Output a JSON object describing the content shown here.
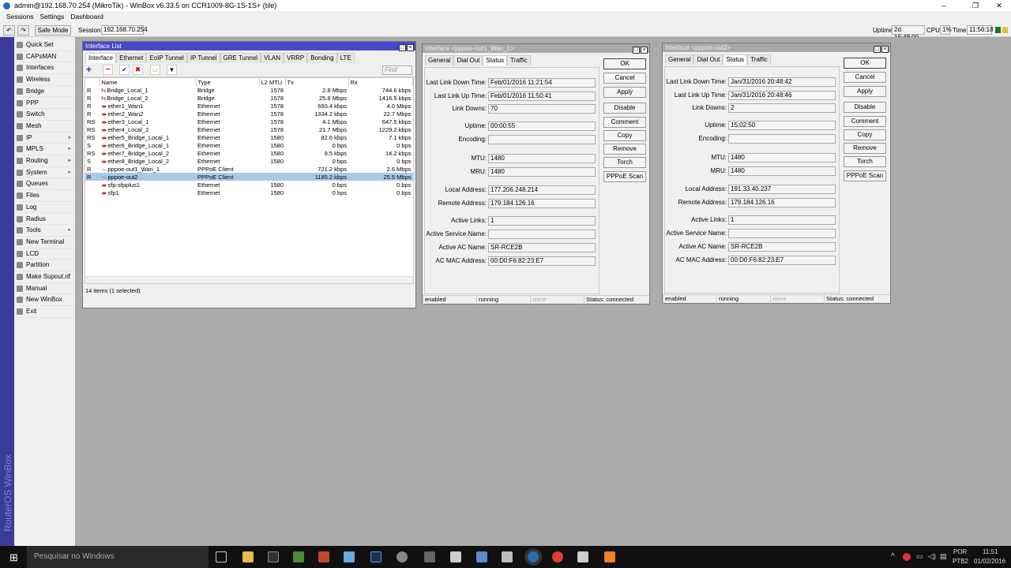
{
  "window": {
    "title": "admin@192.168.70.254 (MikroTik) - WinBox v6.33.5 on CCR1009-8G-1S-1S+ (tile)",
    "minimize": "–",
    "maximize": "❐",
    "close": "✕"
  },
  "menu": [
    "Sessions",
    "Settings",
    "Dashboard"
  ],
  "toolbar": {
    "undo": "↶",
    "redo": "↷",
    "safe_mode": "Safe Mode",
    "session_label": "Session:",
    "session_value": "192.168.70.254",
    "uptime_label": "Uptime:",
    "uptime_value": "2d 16:48:00",
    "cpu_label": "CPU:",
    "cpu_value": "1%",
    "time_label": "Time:",
    "time_value": "11:56:18",
    "status_color": "#1a7a1a"
  },
  "sidebar": {
    "brand": "RouterOS WinBox",
    "items": [
      {
        "label": "Quick Set",
        "arrow": ""
      },
      {
        "label": "CAPsMAN",
        "arrow": ""
      },
      {
        "label": "Interfaces",
        "arrow": ""
      },
      {
        "label": "Wireless",
        "arrow": ""
      },
      {
        "label": "Bridge",
        "arrow": ""
      },
      {
        "label": "PPP",
        "arrow": ""
      },
      {
        "label": "Switch",
        "arrow": ""
      },
      {
        "label": "Mesh",
        "arrow": ""
      },
      {
        "label": "IP",
        "arrow": "▸"
      },
      {
        "label": "MPLS",
        "arrow": "▸"
      },
      {
        "label": "Routing",
        "arrow": "▸"
      },
      {
        "label": "System",
        "arrow": "▸"
      },
      {
        "label": "Queues",
        "arrow": ""
      },
      {
        "label": "Files",
        "arrow": ""
      },
      {
        "label": "Log",
        "arrow": ""
      },
      {
        "label": "Radius",
        "arrow": ""
      },
      {
        "label": "Tools",
        "arrow": "▸"
      },
      {
        "label": "New Terminal",
        "arrow": ""
      },
      {
        "label": "LCD",
        "arrow": ""
      },
      {
        "label": "Partition",
        "arrow": ""
      },
      {
        "label": "Make Supout.rif",
        "arrow": ""
      },
      {
        "label": "Manual",
        "arrow": ""
      },
      {
        "label": "New WinBox",
        "arrow": ""
      },
      {
        "label": "Exit",
        "arrow": ""
      }
    ]
  },
  "interface_list": {
    "title": "Interface List",
    "tabs": [
      "Interface",
      "Ethernet",
      "EoIP Tunnel",
      "IP Tunnel",
      "GRE Tunnel",
      "VLAN",
      "VRRP",
      "Bonding",
      "LTE"
    ],
    "active_tab": 0,
    "find_placeholder": "Find",
    "columns": [
      "",
      "Name",
      "Type",
      "L2 MTU",
      "Tx",
      "Rx"
    ],
    "rows": [
      [
        "R",
        "Bridge_Local_1",
        "Bridge",
        "1578",
        "2.8 Mbps",
        "744.6 kbps"
      ],
      [
        "R",
        "Bridge_Local_2",
        "Bridge",
        "1578",
        "25.8 Mbps",
        "1416.5 kbps"
      ],
      [
        "R",
        "ether1_Wan1",
        "Ethernet",
        "1578",
        "693.4 kbps",
        "4.0 Mbps"
      ],
      [
        "R",
        "ether2_Wan2",
        "Ethernet",
        "1578",
        "1334.2 kbps",
        "22.7 Mbps"
      ],
      [
        "RS",
        "ether3_Local_1",
        "Ethernet",
        "1578",
        "4.1 Mbps",
        "647.5 kbps"
      ],
      [
        "RS",
        "ether4_Local_2",
        "Ethernet",
        "1578",
        "21.7 Mbps",
        "1229.2 kbps"
      ],
      [
        "RS",
        "ether5_Bridge_Local_1",
        "Ethernet",
        "1580",
        "82.6 kbps",
        "7.1 kbps"
      ],
      [
        "S",
        "ether6_Bridge_Local_1",
        "Ethernet",
        "1580",
        "0 bps",
        "0 bps"
      ],
      [
        "RS",
        "ether7_Bridge_Local_2",
        "Ethernet",
        "1580",
        "9.5 kbps",
        "14.2 kbps"
      ],
      [
        "S",
        "ether8_Bridge_Local_2",
        "Ethernet",
        "1580",
        "0 bps",
        "0 bps"
      ],
      [
        "R",
        "pppoe-out1_Wan_1",
        "PPPoE Client",
        "",
        "721.2 kbps",
        "2.6 Mbps"
      ],
      [
        "R",
        "pppoe-out2",
        "PPPoE Client",
        "",
        "1185.2 kbps",
        "25.5 Mbps"
      ],
      [
        "",
        "sfp-sfpplus1",
        "Ethernet",
        "1580",
        "0 bps",
        "0 bps"
      ],
      [
        "",
        "sfp1",
        "Ethernet",
        "1580",
        "0 bps",
        "0 bps"
      ]
    ],
    "selected_row": 11,
    "status": "14 items (1 selected)"
  },
  "dialogs": [
    {
      "title": "Interface <pppoe-out1_Wan_1>",
      "tabs": [
        "General",
        "Dial Out",
        "Status",
        "Traffic"
      ],
      "active_tab": 2,
      "fields": [
        [
          "Last Link Down Time:",
          "Feb/01/2016 11:21:54"
        ],
        [
          "Last Link Up Time:",
          "Feb/01/2016 11:50:41"
        ],
        [
          "Link Downs:",
          "70"
        ],
        [
          "Uptime:",
          "00:00:55"
        ],
        [
          "Encoding:",
          ""
        ],
        [
          "MTU:",
          "1480"
        ],
        [
          "MRU:",
          "1480"
        ],
        [
          "Local Address:",
          "177.206.248.214"
        ],
        [
          "Remote Address:",
          "179.184.126.16"
        ],
        [
          "Active Links:",
          "1"
        ],
        [
          "Active Service Name:",
          ""
        ],
        [
          "Active AC Name:",
          "SR-RCE2B"
        ],
        [
          "AC MAC Address:",
          "00:D0:F6:82:23:E7"
        ]
      ],
      "buttons": [
        "OK",
        "Cancel",
        "Apply",
        "Disable",
        "Comment",
        "Copy",
        "Remove",
        "Torch",
        "PPPoE Scan"
      ],
      "status": [
        "enabled",
        "running",
        "slave",
        "Status: connected"
      ]
    },
    {
      "title": "Interface <pppoe-out2>",
      "tabs": [
        "General",
        "Dial Out",
        "Status",
        "Traffic"
      ],
      "active_tab": 2,
      "fields": [
        [
          "Last Link Down Time:",
          "Jan/31/2016 20:48:42"
        ],
        [
          "Last Link Up Time:",
          "Jan/31/2016 20:48:46"
        ],
        [
          "Link Downs:",
          "2"
        ],
        [
          "Uptime:",
          "15:02:50"
        ],
        [
          "Encoding:",
          ""
        ],
        [
          "MTU:",
          "1480"
        ],
        [
          "MRU:",
          "1480"
        ],
        [
          "Local Address:",
          "191.33.40.237"
        ],
        [
          "Remote Address:",
          "179.184.126.16"
        ],
        [
          "Active Links:",
          "1"
        ],
        [
          "Active Service Name:",
          ""
        ],
        [
          "Active AC Name:",
          "SR-RCE2B"
        ],
        [
          "AC MAC Address:",
          "00:D0:F6:82:23:E7"
        ]
      ],
      "buttons": [
        "OK",
        "Cancel",
        "Apply",
        "Disable",
        "Comment",
        "Copy",
        "Remove",
        "Torch",
        "PPPoE Scan"
      ],
      "status": [
        "enabled",
        "running",
        "slave",
        "Status: connected"
      ]
    }
  ],
  "taskbar": {
    "search_placeholder": "Pesquisar no Windows",
    "lang1": "POR",
    "lang2": "PTB2",
    "time": "11:51",
    "date": "01/02/2016"
  }
}
